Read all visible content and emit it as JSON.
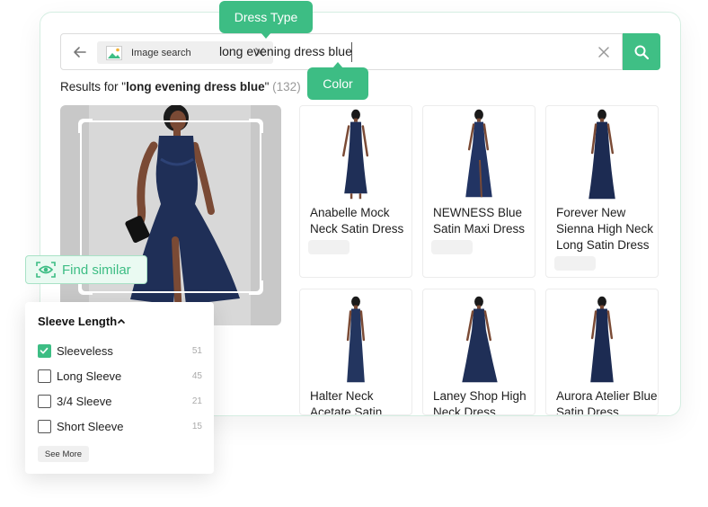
{
  "tooltips": {
    "dress_type": "Dress Type",
    "color": "Color"
  },
  "search": {
    "image_chip_label": "Image search",
    "query": "long evening dress blue"
  },
  "results": {
    "prefix": "Results for \"",
    "query": "long evening dress blue",
    "suffix": "\" ",
    "count": "(132)"
  },
  "find_similar": {
    "label": "Find similar"
  },
  "products": [
    {
      "title": "Anabelle Mock Neck Satin Dress"
    },
    {
      "title": "NEWNESS Blue Satin Maxi Dress"
    },
    {
      "title": "Forever New Sienna High Neck Long Satin Dress"
    },
    {
      "title": "Halter Neck Acetate Satin"
    },
    {
      "title": "Laney Shop High Neck Dress"
    },
    {
      "title": "Aurora Atelier Blue Satin Dress"
    }
  ],
  "filter": {
    "title": "Sleeve Length",
    "options": [
      {
        "label": "Sleeveless",
        "count": "51",
        "checked": true
      },
      {
        "label": "Long Sleeve",
        "count": "45",
        "checked": false
      },
      {
        "label": "3/4 Sleeve",
        "count": "21",
        "checked": false
      },
      {
        "label": "Short Sleeve",
        "count": "15",
        "checked": false
      }
    ],
    "see_more": "See More"
  },
  "colors": {
    "accent": "#3dbd84",
    "dress": "#1f2f57",
    "skin": "#7a4a35"
  }
}
